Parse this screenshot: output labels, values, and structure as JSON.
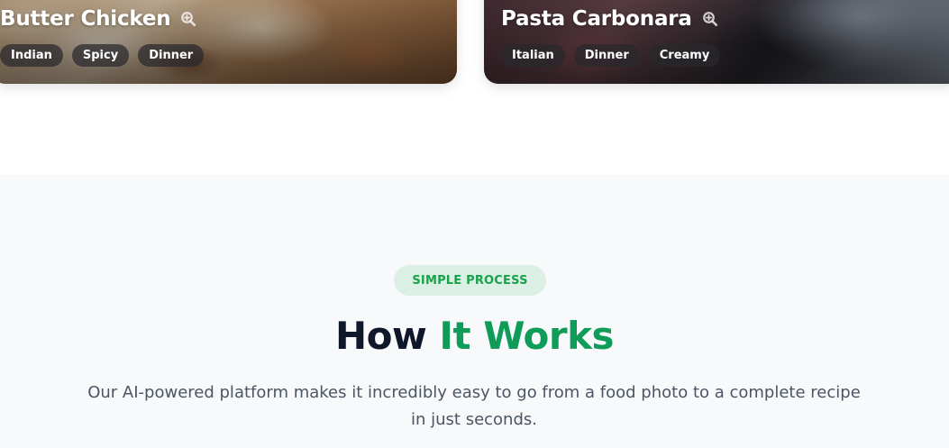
{
  "cards": [
    {
      "title": "Butter Chicken",
      "tags": [
        "Indian",
        "Spicy",
        "Dinner"
      ]
    },
    {
      "title": "Pasta Carbonara",
      "tags": [
        "Italian",
        "Dinner",
        "Creamy"
      ]
    }
  ],
  "how_it_works": {
    "badge": "SIMPLE PROCESS",
    "heading_part1": "How",
    "heading_part2": "It Works",
    "description": "Our AI-powered platform makes it incredibly easy to go from a food photo to a complete recipe in just seconds."
  },
  "colors": {
    "accent_green": "#0f9b58",
    "badge_bg": "#dcefe4",
    "heading_dark": "#0f172a",
    "section_bg": "#f7f9fb"
  },
  "icons": {
    "card_zoom": "zoom-in-icon"
  }
}
